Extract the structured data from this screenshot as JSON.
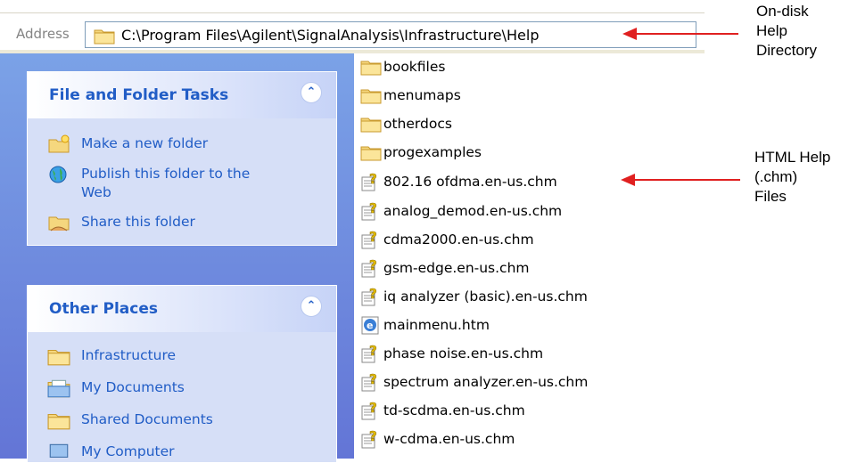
{
  "address": {
    "label": "Address",
    "path": "C:\\Program Files\\Agilent\\SignalAnalysis\\Infrastructure\\Help"
  },
  "tasks_panel": {
    "title": "File and Folder Tasks",
    "items": [
      {
        "label": "Make a new folder",
        "icon": "new-folder-icon"
      },
      {
        "label": "Publish this folder to the Web",
        "icon": "globe-icon"
      },
      {
        "label": "Share this folder",
        "icon": "share-folder-icon"
      }
    ]
  },
  "places_panel": {
    "title": "Other Places",
    "items": [
      {
        "label": "Infrastructure",
        "icon": "folder-icon"
      },
      {
        "label": "My Documents",
        "icon": "my-documents-icon"
      },
      {
        "label": "Shared Documents",
        "icon": "folder-icon"
      },
      {
        "label": "My Computer",
        "icon": "computer-icon"
      }
    ]
  },
  "files": [
    {
      "name": "bookfiles",
      "type": "folder"
    },
    {
      "name": "menumaps",
      "type": "folder"
    },
    {
      "name": "otherdocs",
      "type": "folder"
    },
    {
      "name": "progexamples",
      "type": "folder"
    },
    {
      "name": "802.16 ofdma.en-us.chm",
      "type": "chm"
    },
    {
      "name": "analog_demod.en-us.chm",
      "type": "chm"
    },
    {
      "name": "cdma2000.en-us.chm",
      "type": "chm"
    },
    {
      "name": "gsm-edge.en-us.chm",
      "type": "chm"
    },
    {
      "name": "iq analyzer (basic).en-us.chm",
      "type": "chm"
    },
    {
      "name": "mainmenu.htm",
      "type": "htm"
    },
    {
      "name": "phase noise.en-us.chm",
      "type": "chm"
    },
    {
      "name": "spectrum analyzer.en-us.chm",
      "type": "chm"
    },
    {
      "name": "td-scdma.en-us.chm",
      "type": "chm"
    },
    {
      "name": "w-cdma.en-us.chm",
      "type": "chm"
    }
  ],
  "annotations": {
    "top": [
      "On-disk",
      "Help",
      "Directory"
    ],
    "bottom": [
      "HTML Help",
      "(.chm)",
      "Files"
    ]
  },
  "colors": {
    "annotation_arrow": "#e02020",
    "task_link": "#215dc6",
    "pane_gradient_top": "#7ba2e7",
    "pane_gradient_bottom": "#6375d6"
  }
}
